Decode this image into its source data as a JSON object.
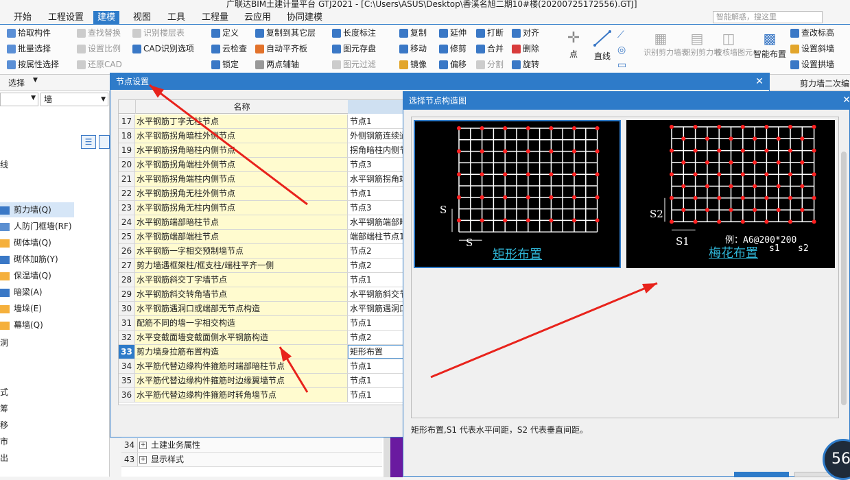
{
  "window": {
    "title": "广联达BIM土建计量平台 GTJ2021 - [C:\\Users\\ASUS\\Desktop\\香溪名旭二期10#楼(20200725172556).GTJ]"
  },
  "tabs": [
    "开始",
    "工程设置",
    "建模",
    "视图",
    "工具",
    "工程量",
    "云应用",
    "协同建模"
  ],
  "search_placeholder": "智能解惑，搜这里",
  "ribbon": {
    "select_group": [
      "拾取构件",
      "批量选择",
      "按属性选择"
    ],
    "select_label": "选择",
    "find_group": [
      "查找替换",
      "设置比例",
      "还原CAD"
    ],
    "cad_group": [
      "识别楼层表",
      "CAD识别选项"
    ],
    "def_group": [
      "定义",
      "云检查",
      "锁定"
    ],
    "copy_group": [
      "复制到其它层",
      "自动平齐板",
      "两点辅轴"
    ],
    "dim_group": [
      "长度标注",
      "图元存盘",
      "图元过滤"
    ],
    "edit_group": [
      "复制",
      "移动",
      "镜像",
      "延伸",
      "修剪",
      "偏移",
      "打断",
      "合并",
      "分割",
      "对齐",
      "删除",
      "旋转"
    ],
    "draw_group": [
      "点",
      "直线"
    ],
    "recog_group": [
      "识别剪力墙表",
      "识别剪力墙",
      "校核墙图元"
    ],
    "smart_label": "智能布置",
    "wall_group": [
      "查改标高",
      "设置斜墙",
      "设置拱墙"
    ],
    "panel_title_right": "剪力墙二次编"
  },
  "left_filter": {
    "combo1": "",
    "combo2": "墙"
  },
  "left_items": [
    "剪力墙(Q)",
    "人防门框墙(RF)",
    "砌体墙(Q)",
    "砌体加筋(Y)",
    "保温墙(Q)",
    "暗梁(A)",
    "墙垛(E)",
    "幕墙(Q)"
  ],
  "left_misc": [
    "洞",
    "式",
    "筹",
    "移",
    "市",
    "出",
    "线"
  ],
  "dialog": {
    "title": "节点设置",
    "col_name": "名称",
    "rows": [
      {
        "n": "17",
        "name": "水平钢筋丁字无柱节点",
        "val": "节点1"
      },
      {
        "n": "18",
        "name": "水平钢筋拐角暗柱外侧节点",
        "val": "外侧钢筋连续通过"
      },
      {
        "n": "19",
        "name": "水平钢筋拐角暗柱内侧节点",
        "val": "拐角暗柱内侧节点"
      },
      {
        "n": "20",
        "name": "水平钢筋拐角端柱外侧节点",
        "val": "节点3"
      },
      {
        "n": "21",
        "name": "水平钢筋拐角端柱内侧节点",
        "val": "水平钢筋拐角端柱"
      },
      {
        "n": "22",
        "name": "水平钢筋拐角无柱外侧节点",
        "val": "节点1"
      },
      {
        "n": "23",
        "name": "水平钢筋拐角无柱内侧节点",
        "val": "节点3"
      },
      {
        "n": "24",
        "name": "水平钢筋端部暗柱节点",
        "val": "水平钢筋端部暗柱"
      },
      {
        "n": "25",
        "name": "水平钢筋端部端柱节点",
        "val": "端部端柱节点1"
      },
      {
        "n": "26",
        "name": "水平钢筋一字相交预制墙节点",
        "val": "节点2"
      },
      {
        "n": "27",
        "name": "剪力墙遇框架柱/框支柱/端柱平齐一侧",
        "val": "节点2"
      },
      {
        "n": "28",
        "name": "水平钢筋斜交丁字墙节点",
        "val": "节点1"
      },
      {
        "n": "29",
        "name": "水平钢筋斜交转角墙节点",
        "val": "水平钢筋斜交节点"
      },
      {
        "n": "30",
        "name": "水平钢筋遇洞口或端部无节点构造",
        "val": "水平钢筋遇洞口"
      },
      {
        "n": "31",
        "name": "配筋不同的墙一字相交构造",
        "val": "节点1"
      },
      {
        "n": "32",
        "name": "水平变截面墙变截面侧水平钢筋构造",
        "val": "节点2"
      },
      {
        "n": "33",
        "name": "剪力墙身拉筋布置构造",
        "val": "矩形布置"
      },
      {
        "n": "34",
        "name": "水平筋代替边缘构件箍筋时端部暗柱节点",
        "val": "节点1"
      },
      {
        "n": "35",
        "name": "水平筋代替边缘构件箍筋时边缘翼墙节点",
        "val": "节点1"
      },
      {
        "n": "36",
        "name": "水平筋代替边缘构件箍筋时转角墙节点",
        "val": "节点1"
      }
    ]
  },
  "panel": {
    "title": "选择节点构造图",
    "option_rect": "矩形布置",
    "option_plum": "梅花布置",
    "label_s": "S",
    "label_s1": "S1",
    "label_s2": "S2",
    "example": "例：A6@200*200",
    "example_s1": "s1",
    "example_s2": "s2",
    "description": "矩形布置,S1 代表水平间距，S2 代表垂直间距。"
  },
  "bottom_rows": [
    {
      "n": "34",
      "txt": "土建业务属性"
    },
    {
      "n": "43",
      "txt": "显示样式"
    }
  ],
  "badge": "56",
  "colors": {
    "accent": "#2e7bc9",
    "highlight": "#fffbcf",
    "rebar": "#ff2020",
    "arrow": "#e8231c",
    "caption": "#2fb5d6"
  }
}
